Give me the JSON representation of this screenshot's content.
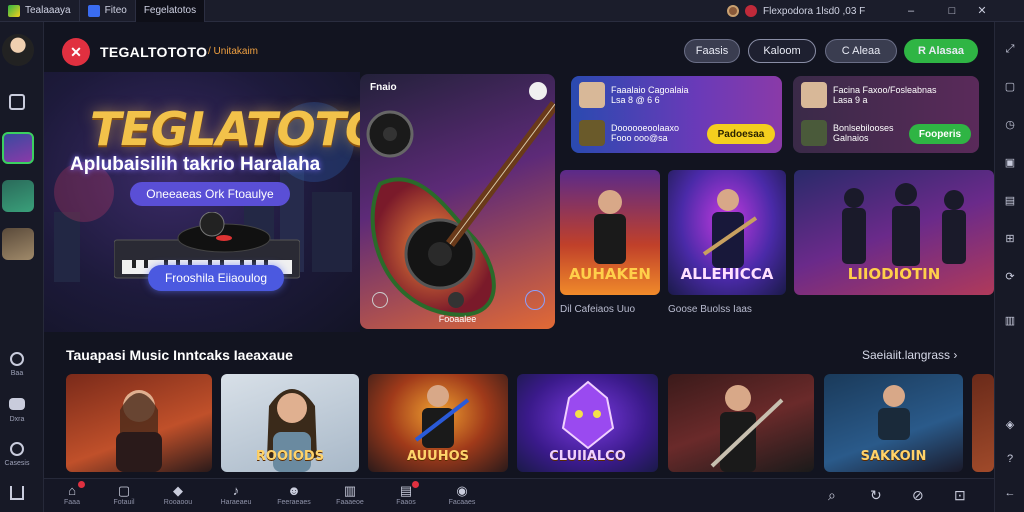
{
  "window": {
    "tabs": [
      {
        "label": "Tealaaaya"
      },
      {
        "label": "Fiteo"
      },
      {
        "label": "Fegelatotos"
      }
    ],
    "address": "Flexpodora 1lsd0 ,03 F",
    "controls": [
      "–",
      "□",
      "✕"
    ]
  },
  "left_rail": {
    "labels": [
      "Baa",
      "Dxra",
      "Casesis"
    ]
  },
  "header": {
    "brand": "TEGALTOTOTO",
    "brand_sub": "/ Unitakaim",
    "buttons": [
      "Faasis",
      "Kaloom",
      "C Aleaa",
      "R Alasaa"
    ]
  },
  "hero": {
    "title": "TEGLATOTO",
    "tagline": "Aplubaisilih takrio Haralaha",
    "pill": "Oneeaeas Ork Ftoaulye",
    "cta": "Frooshila Eiiaoulog"
  },
  "feature": {
    "tag": "Fnaio",
    "footer": "Fooaalee"
  },
  "promos": [
    {
      "row1": "Faaalaio Cagoalaia",
      "row1b": "Lsa 8 @ 6 6",
      "row2": "Doooooeoolaaxo",
      "row2b": "Fooo ooo@sa",
      "button": "Padoesaa"
    },
    {
      "row1": "Facina Faxoo/Fosleabnas",
      "row1b": "Lasa 9 a",
      "row2": "Bonlsebilooses",
      "row2b": "Galnaios",
      "button": "Fooperis"
    }
  ],
  "mid_cards": [
    {
      "label": "AUHAKEN",
      "caption": "Dil Cafeiaos Uuo"
    },
    {
      "label": "ALLEHICCA",
      "caption": "Goose Buolss Iaas"
    },
    {
      "label": "LIIODIOTIN",
      "caption": ""
    }
  ],
  "section": {
    "title": "Tauapasi Music Inntcaks Iaeaxaue",
    "more": "Saeiaiit.langrass"
  },
  "bottom_cards": [
    {
      "label": ""
    },
    {
      "label": "ROOIODS"
    },
    {
      "label": "AUUHOS"
    },
    {
      "label": "CLUIIALCO"
    },
    {
      "label": ""
    },
    {
      "label": "SAKKOIN"
    },
    {
      "label": ""
    }
  ],
  "bottom_nav": [
    "Faaa",
    "Fotauil",
    "Rooaoou",
    "Haraeaeu",
    "Feeraeaes",
    "Faaaeoe",
    "Faaos",
    "Facaaes"
  ],
  "colors": {
    "accent_red": "#e03040",
    "gold": "#f2c24a",
    "green": "#2fb544",
    "yellow": "#f4cf1e",
    "purple": "#5a4fd6"
  }
}
